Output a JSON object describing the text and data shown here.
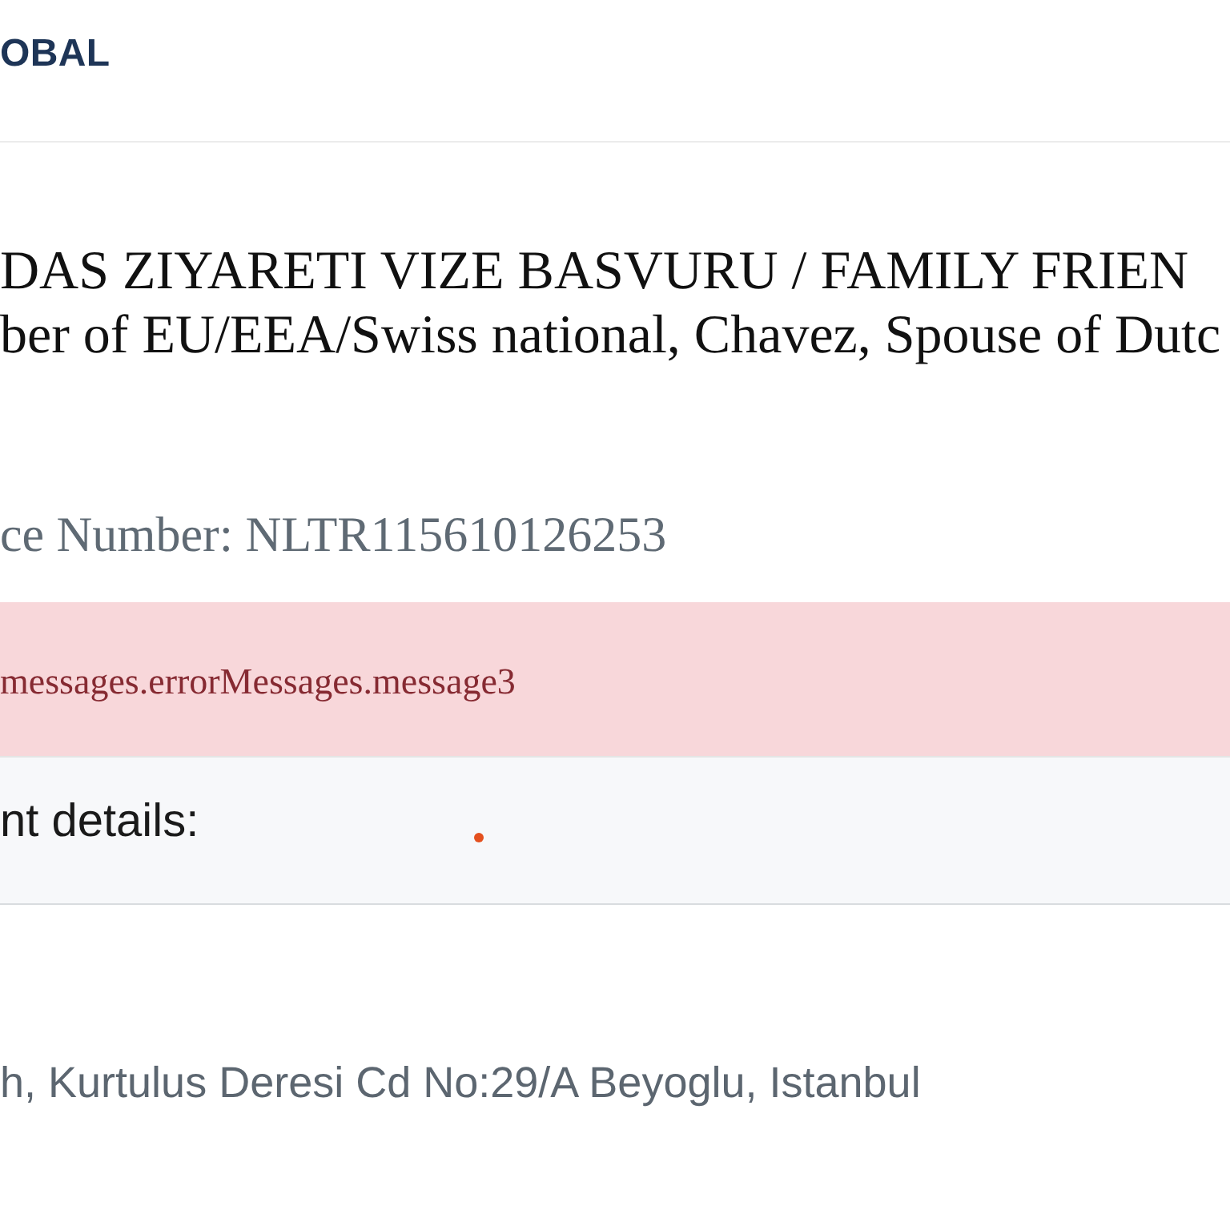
{
  "header": {
    "logo_text": "OBAL"
  },
  "application": {
    "title_lines": [
      "DAS ZIYARETI VIZE BASVURU / FAMILY FRIEN",
      "ber of EU/EEA/Swiss national, Chavez, Spouse of Dutc"
    ],
    "reference": "ce Number: NLTR115610126253"
  },
  "alert": {
    "kind": "danger",
    "message": "messages.errorMessages.message3"
  },
  "appointment_details": {
    "heading": "nt details:"
  },
  "address": "h, Kurtulus Deresi Cd No:29/A Beyoglu, Istanbul"
}
